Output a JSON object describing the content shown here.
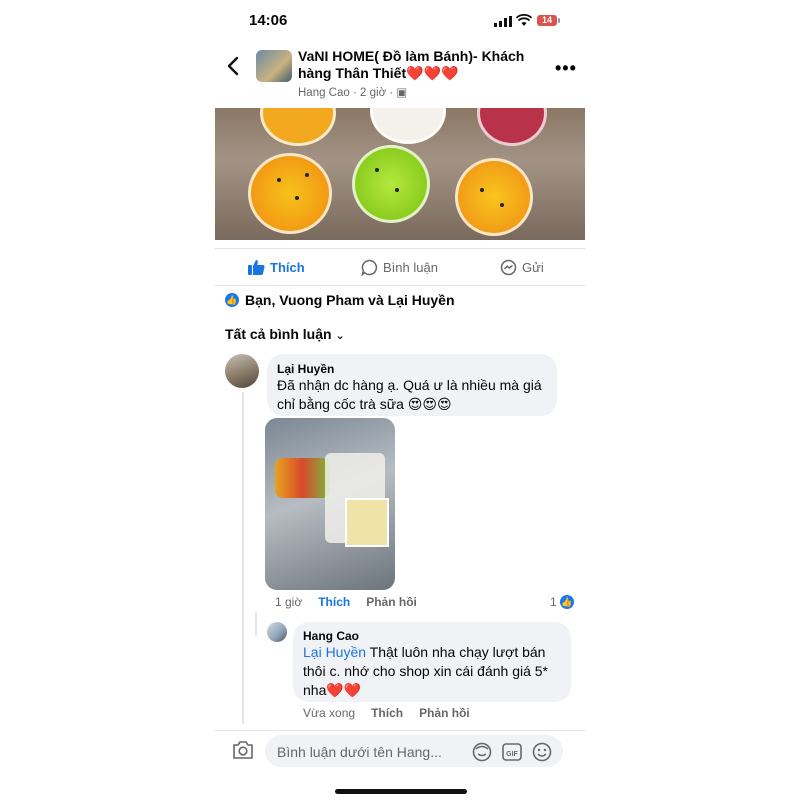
{
  "status": {
    "time": "14:06",
    "battery": "14"
  },
  "header": {
    "title": "VaNI HOME( Đồ làm Bánh)- Khách hàng Thân Thiết",
    "title_hearts": "❤️❤️❤️",
    "author": "Hang Cao",
    "time": "2 giờ"
  },
  "post_actions": {
    "like": "Thích",
    "comment": "Bình luận",
    "send": "Gửi"
  },
  "reactions": {
    "text": "Bạn, Vuong Pham và Lại Huyền"
  },
  "comments_filter": {
    "label": "Tất cả bình luận"
  },
  "comment1": {
    "name": "Lại Huyền",
    "text": "Đã nhận dc hàng ạ. Quá ư là nhiều mà giá chỉ bằng cốc trà sữa 😍😍😍",
    "time": "1 giờ",
    "like": "Thích",
    "reply": "Phản hồi",
    "reaction_count": "1"
  },
  "reply1": {
    "name": "Hang Cao",
    "mention": "Lại Huyền",
    "text": " Thật luôn nha chạy lượt bán thôi c. nhớ cho shop xin cái đánh giá 5* nha❤️❤️",
    "time": "Vừa xong",
    "like": "Thích",
    "reply": "Phản hồi"
  },
  "composer": {
    "placeholder": "Bình luận dưới tên Hang..."
  },
  "colors": {
    "accent": "#1b74e4",
    "bubble": "#f0f2f5",
    "muted": "#65676b"
  }
}
